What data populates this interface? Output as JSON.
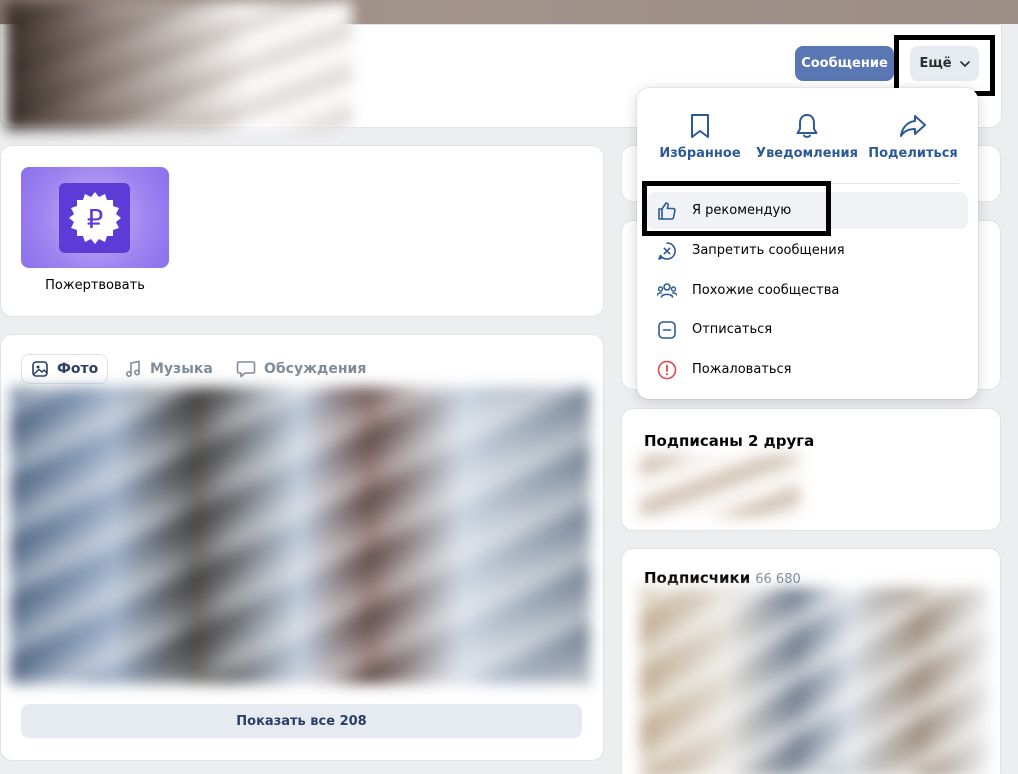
{
  "header": {
    "message_button": "Сообщение",
    "more_button": "Ещё"
  },
  "donate": {
    "label": "Пожертвовать"
  },
  "media": {
    "tabs": [
      {
        "label": "Фото",
        "icon": "photo-icon"
      },
      {
        "label": "Музыка",
        "icon": "music-icon"
      },
      {
        "label": "Обсуждения",
        "icon": "discussion-icon"
      }
    ],
    "show_all": "Показать все 208"
  },
  "friends": {
    "title": "Подписаны 2 друга"
  },
  "subscribers": {
    "title": "Подписчики",
    "count": "66 680"
  },
  "dropdown": {
    "quick_actions": [
      {
        "label": "Избранное",
        "icon": "bookmark-icon"
      },
      {
        "label": "Уведомления",
        "icon": "bell-icon"
      },
      {
        "label": "Поделиться",
        "icon": "share-icon"
      }
    ],
    "items": [
      {
        "label": "Я рекомендую",
        "icon": "thumbs-up-icon"
      },
      {
        "label": "Запретить сообщения",
        "icon": "block-messages-icon"
      },
      {
        "label": "Похожие сообщества",
        "icon": "users-icon"
      },
      {
        "label": "Отписаться",
        "icon": "unsubscribe-icon"
      },
      {
        "label": "Пожаловаться",
        "icon": "report-icon"
      }
    ]
  },
  "colors": {
    "accent": "#5a77b4",
    "link": "#2c5a99",
    "donate": "#5d3bd6",
    "report": "#e64646"
  }
}
